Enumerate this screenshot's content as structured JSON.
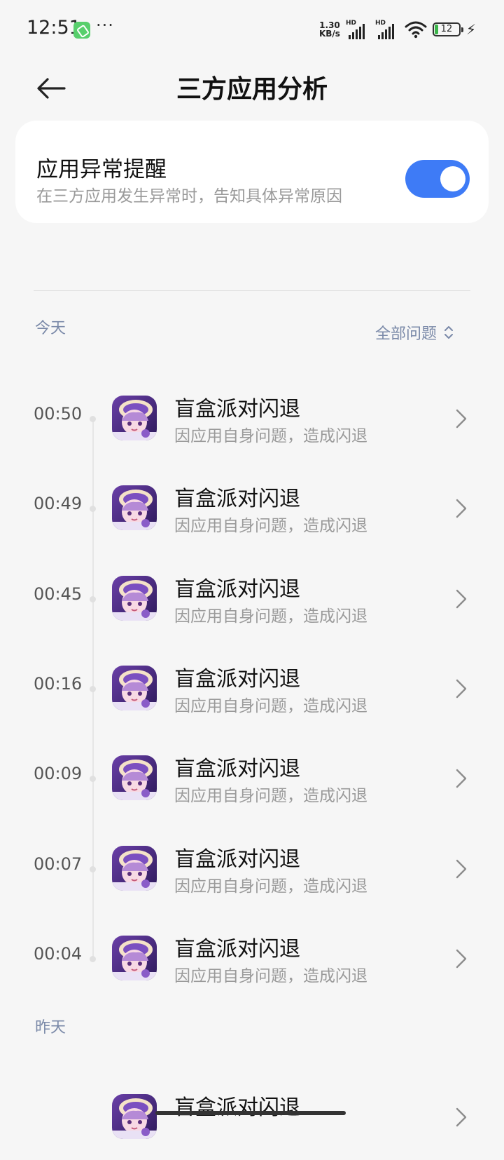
{
  "status_bar": {
    "time": "12:51",
    "more": "···",
    "net_speed_value": "1.30",
    "net_speed_unit": "KB/s",
    "sim1_label": "HD",
    "sim2_label": "HD",
    "battery_level": "12",
    "icons": [
      "phone-app-notification-icon",
      "signal-icon",
      "wifi-icon",
      "battery-icon",
      "charging-icon"
    ]
  },
  "header": {
    "title": "三方应用分析",
    "back_icon": "back-arrow-icon"
  },
  "alert_card": {
    "title": "应用异常提醒",
    "subtitle": "在三方应用发生异常时，告知具体异常原因",
    "toggle_on": true,
    "accent_color": "#3e7bf6"
  },
  "sections": {
    "today_label": "今天",
    "filter_label": "全部问题",
    "yesterday_label": "昨天"
  },
  "today_items": [
    {
      "time": "00:50",
      "title": "盲盒派对闪退",
      "subtitle": "因应用自身问题，造成闪退"
    },
    {
      "time": "00:49",
      "title": "盲盒派对闪退",
      "subtitle": "因应用自身问题，造成闪退"
    },
    {
      "time": "00:45",
      "title": "盲盒派对闪退",
      "subtitle": "因应用自身问题，造成闪退"
    },
    {
      "time": "00:16",
      "title": "盲盒派对闪退",
      "subtitle": "因应用自身问题，造成闪退"
    },
    {
      "time": "00:09",
      "title": "盲盒派对闪退",
      "subtitle": "因应用自身问题，造成闪退"
    },
    {
      "time": "00:07",
      "title": "盲盒派对闪退",
      "subtitle": "因应用自身问题，造成闪退"
    },
    {
      "time": "00:04",
      "title": "盲盒派对闪退",
      "subtitle": "因应用自身问题，造成闪退"
    }
  ],
  "yesterday_items": [
    {
      "time": "",
      "title": "盲盒派对闪退",
      "subtitle": ""
    }
  ]
}
